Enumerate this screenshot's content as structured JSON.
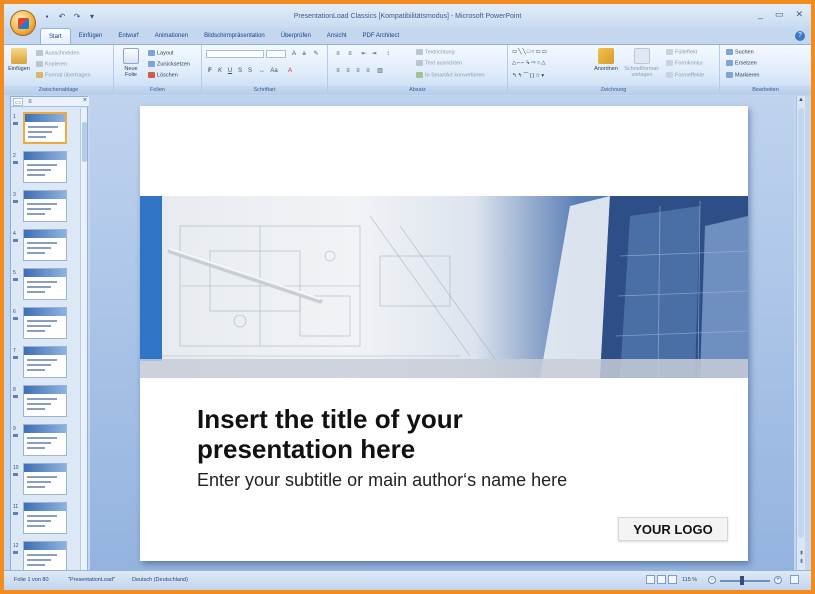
{
  "window": {
    "title": "PresentationLoad Classics [Kompatibilitätsmodus] - Microsoft PowerPoint",
    "controls": [
      "_",
      "▭",
      "✕"
    ]
  },
  "ribbon_tabs": [
    "Start",
    "Einfügen",
    "Entwurf",
    "Animationen",
    "Bildschirmpräsentation",
    "Überprüfen",
    "Ansicht",
    "PDF Architect"
  ],
  "ribbon": {
    "clipboard": {
      "label": "Zwischenablage",
      "paste": "Einfügen",
      "cut": "Ausschneiden",
      "copy": "Kopieren",
      "format_painter": "Format übertragen"
    },
    "slides": {
      "label": "Folien",
      "new_slide": "Neue Folie",
      "layout": "Layout",
      "reset": "Zurücksetzen",
      "delete": "Löschen"
    },
    "font": {
      "label": "Schriftart",
      "font_name": "",
      "font_size": ""
    },
    "paragraph": {
      "label": "Absatz",
      "text_direction": "Textrichtung",
      "align_text": "Text ausrichten",
      "smartart": "In SmartArt konvertieren"
    },
    "drawing": {
      "label": "Zeichnung",
      "arrange": "Anordnen",
      "quick_styles": "Schnellformat-vorlagen",
      "fill": "Fülleffekt",
      "outline": "Formkontur",
      "effects": "Formeffekte"
    },
    "editing": {
      "label": "Bearbeiten",
      "find": "Suchen",
      "replace": "Ersetzen",
      "select": "Markieren"
    }
  },
  "slides_pane": {
    "tabs": [
      "Folien",
      "Gliederung"
    ],
    "slide_numbers": [
      "1",
      "2",
      "3",
      "4",
      "5",
      "6",
      "7",
      "8",
      "9",
      "10",
      "11",
      "12"
    ],
    "selected": "1"
  },
  "slide": {
    "title": "Insert the title of your presentation here",
    "subtitle": "Enter your subtitle or main author‘s name here",
    "logo": "YOUR LOGO"
  },
  "status": {
    "slide_count": "Folie 1 von 80",
    "theme": "\"PresentationLoad\"",
    "language": "Deutsch (Deutschland)",
    "zoom": "115 %"
  },
  "colors": {
    "accent": "#2f74c5",
    "frame": "#f28c1e"
  }
}
